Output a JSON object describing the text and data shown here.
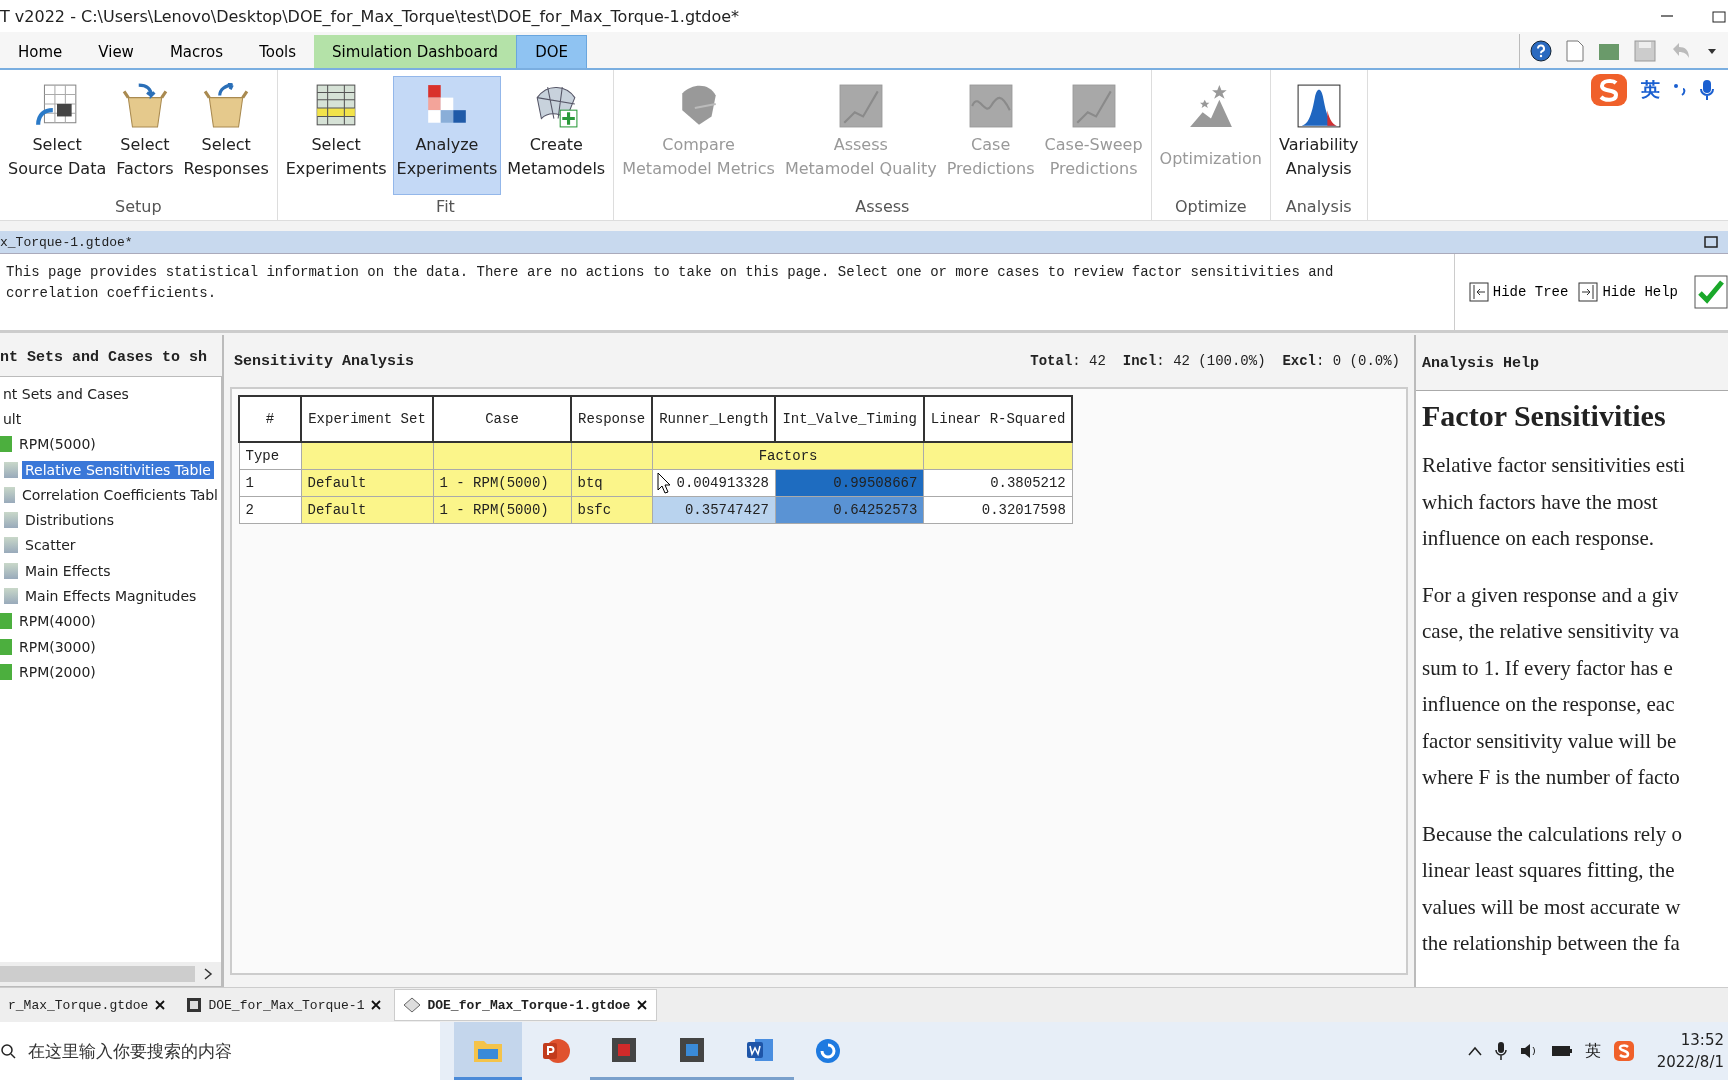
{
  "window": {
    "title": "T v2022 - C:\\Users\\Lenovo\\Desktop\\DOE_for_Max_Torque\\test\\DOE_for_Max_Torque-1.gtdoe*"
  },
  "tabs": [
    {
      "label": "Home",
      "selected": false
    },
    {
      "label": "View",
      "selected": false
    },
    {
      "label": "Macros",
      "selected": false
    },
    {
      "label": "Tools",
      "selected": false
    },
    {
      "label": "Simulation Dashboard",
      "selected": false,
      "color": "#b4e2a8"
    },
    {
      "label": "DOE",
      "selected": true
    }
  ],
  "ime_bar": {
    "language": "英"
  },
  "ribbon": {
    "groups": [
      {
        "label": "Setup",
        "buttons": [
          {
            "lines": [
              "Select",
              "Source Data"
            ],
            "disabled": false,
            "selected": false
          },
          {
            "lines": [
              "Select",
              "Factors"
            ],
            "disabled": false,
            "selected": false
          },
          {
            "lines": [
              "Select",
              "Responses"
            ],
            "disabled": false,
            "selected": false
          }
        ]
      },
      {
        "label": "Fit",
        "buttons": [
          {
            "lines": [
              "Select",
              "Experiments"
            ],
            "disabled": false,
            "selected": false
          },
          {
            "lines": [
              "Analyze",
              "Experiments"
            ],
            "disabled": false,
            "selected": true
          },
          {
            "lines": [
              "Create",
              "Metamodels"
            ],
            "disabled": false,
            "selected": false
          }
        ]
      },
      {
        "label": "Assess",
        "buttons": [
          {
            "lines": [
              "Compare",
              "Metamodel Metrics"
            ],
            "disabled": true,
            "selected": false
          },
          {
            "lines": [
              "Assess",
              "Metamodel Quality"
            ],
            "disabled": true,
            "selected": false
          },
          {
            "lines": [
              "Case",
              "Predictions"
            ],
            "disabled": true,
            "selected": false
          },
          {
            "lines": [
              "Case-Sweep",
              "Predictions"
            ],
            "disabled": true,
            "selected": false
          }
        ]
      },
      {
        "label": "Optimize",
        "buttons": [
          {
            "lines": [
              "Optimization"
            ],
            "disabled": true,
            "selected": false
          }
        ]
      },
      {
        "label": "Analysis",
        "buttons": [
          {
            "lines": [
              "Variability",
              "Analysis"
            ],
            "disabled": false,
            "selected": false
          }
        ]
      }
    ]
  },
  "document": {
    "title": "x_Torque-1.gtdoe*"
  },
  "info": {
    "text": "This page provides statistical information on the data. There are no actions to take on this page. Select one or more cases to review factor sensitivities and correlation coefficients.",
    "buttons": [
      "Hide Tree",
      "Hide Help"
    ]
  },
  "tree_panel": {
    "title": "nt Sets and Cases to sh",
    "items": [
      {
        "label": "nt Sets and Cases",
        "children": [
          {
            "label": "ult",
            "children": [
              {
                "label": "RPM(5000)",
                "children": [
                  {
                    "label": "Relative Sensitivities Table",
                    "selected": true
                  },
                  {
                    "label": "Correlation Coefficients Tabl",
                    "selected": false
                  },
                  {
                    "label": "Distributions",
                    "selected": false
                  },
                  {
                    "label": "Scatter",
                    "selected": false
                  },
                  {
                    "label": "Main Effects",
                    "selected": false
                  },
                  {
                    "label": "Main Effects Magnitudes",
                    "selected": false
                  }
                ]
              },
              {
                "label": "RPM(4000)"
              },
              {
                "label": "RPM(3000)"
              },
              {
                "label": "RPM(2000)"
              }
            ]
          }
        ]
      }
    ]
  },
  "analysis": {
    "title": "Sensitivity Analysis",
    "summary": "**Total**: 42  **Incl**: 42 (100.0%)  **Excl**: 0 (0.0%)",
    "table": {
      "columns": [
        "#",
        "Experiment Set",
        "Case",
        "Response",
        "Runner_Length",
        "Int_Valve_Timing",
        "Linear R-Squared"
      ],
      "type_label": "Type",
      "factors_label": "Factors",
      "rows": [
        {
          "num": "1",
          "experiment_set": "Default",
          "case": "1 - RPM(5000)",
          "response": "btq",
          "factors": [
            {
              "value": "0.004913328",
              "color": "#ffffff"
            },
            {
              "value": "0.99508667",
              "color": "#1e6cc0"
            }
          ],
          "r_squared": "0.3805212"
        },
        {
          "num": "2",
          "experiment_set": "Default",
          "case": "1 - RPM(5000)",
          "response": "bsfc",
          "factors": [
            {
              "value": "0.35747427",
              "color": "#b9d3ee"
            },
            {
              "value": "0.64252573",
              "color": "#5a93d4"
            }
          ],
          "r_squared": "0.32017598"
        }
      ]
    }
  },
  "help": {
    "title": "Analysis Help",
    "heading": "Factor Sensitivities",
    "paragraphs": [
      [
        "Relative factor sensitivities esti",
        "which factors have the most",
        "influence on each response."
      ],
      [
        "For a given response and a giv",
        "case, the relative sensitivity va",
        "sum to 1. If every factor has e",
        "influence on the response, eac",
        "factor sensitivity value will be",
        "where F is the number of facto"
      ],
      [
        "Because the calculations rely o",
        "linear least squares fitting, the",
        "values will be most accurate w",
        "the relationship between the fa"
      ]
    ]
  },
  "document_tabs": [
    {
      "label": "r_Max_Torque.gtdoe",
      "selected": false
    },
    {
      "label": "DOE_for_Max_Torque-1",
      "selected": false
    },
    {
      "label": "DOE_for_Max_Torque-1.gtdoe",
      "selected": true
    }
  ],
  "taskbar": {
    "search_placeholder": "在这里输入你要搜索的内容",
    "tray_language": "英",
    "time": "13:52",
    "date": "2022/8/1"
  }
}
